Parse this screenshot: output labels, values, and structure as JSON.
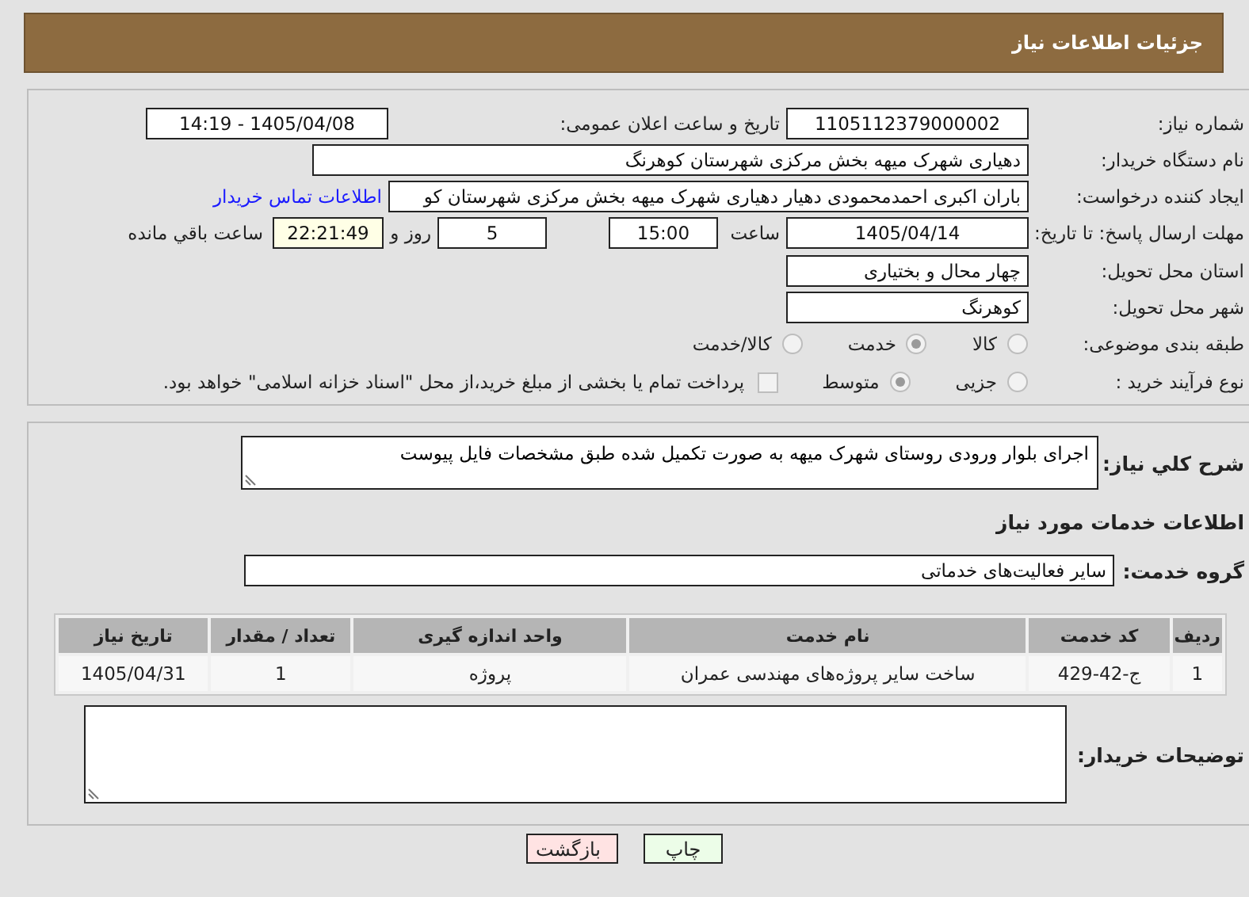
{
  "header": {
    "title": "جزئیات اطلاعات نیاز"
  },
  "details": {
    "need_number": {
      "label": "شماره نیاز:",
      "value": "1105112379000002"
    },
    "announce": {
      "label": "تاریخ و ساعت اعلان عمومی:",
      "value": "1405/04/08 - 14:19"
    },
    "buyer_org": {
      "label": "نام دستگاه خریدار:",
      "value": "دهیاری شهرک میهه بخش مرکزی شهرستان کوهرنگ"
    },
    "creator": {
      "label": "ایجاد کننده درخواست:",
      "value": "باران اکبری احمدمحمودی دهیار دهیاری شهرک میهه بخش مرکزی شهرستان کو",
      "link": "اطلاعات تماس خریدار"
    },
    "deadline": {
      "label": "مهلت ارسال پاسخ: تا تاریخ:",
      "date": "1405/04/14",
      "time_label": "ساعت",
      "time": "15:00",
      "days": "5",
      "days_label": "روز و",
      "remaining": "22:21:49",
      "remaining_label": "ساعت باقي مانده"
    },
    "province": {
      "label": "استان محل تحویل:",
      "value": "چهار محال و بختیاری"
    },
    "city": {
      "label": "شهر محل تحویل:",
      "value": "کوهرنگ"
    },
    "classification": {
      "label": "طبقه بندی موضوعی:",
      "options": [
        {
          "label": "کالا",
          "selected": false
        },
        {
          "label": "خدمت",
          "selected": true
        },
        {
          "label": "کالا/خدمت",
          "selected": false
        }
      ]
    },
    "purchase_type": {
      "label": "نوع فرآیند خرید :",
      "options": [
        {
          "label": "جزیی",
          "selected": false
        },
        {
          "label": "متوسط",
          "selected": true
        }
      ],
      "treasury_payment": {
        "checked": false,
        "text": "پرداخت تمام یا بخشی از مبلغ خرید،از محل \"اسناد خزانه اسلامی\" خواهد بود."
      }
    }
  },
  "services": {
    "description": {
      "label": "شرح کلي نیاز:",
      "value": "اجرای بلوار ورودی روستای شهرک میهه به صورت تکمیل شده طبق مشخصات فایل پیوست"
    },
    "heading": "اطلاعات خدمات مورد نیاز",
    "group": {
      "label": "گروه خدمت:",
      "value": "سایر فعالیت‌های خدماتی"
    },
    "table": {
      "columns": [
        "ردیف",
        "کد خدمت",
        "نام خدمت",
        "واحد اندازه گیری",
        "تعداد / مقدار",
        "تاریخ نیاز"
      ],
      "rows": [
        [
          "1",
          "ج-42-429",
          "ساخت سایر پروژه‌های مهندسی عمران",
          "پروژه",
          "1",
          "1405/04/31"
        ]
      ]
    },
    "buyer_notes": {
      "label": "توضیحات خریدار:"
    }
  },
  "actions": [
    {
      "label": "چاپ",
      "kind": "print"
    },
    {
      "label": "بازگشت",
      "kind": "back"
    }
  ]
}
